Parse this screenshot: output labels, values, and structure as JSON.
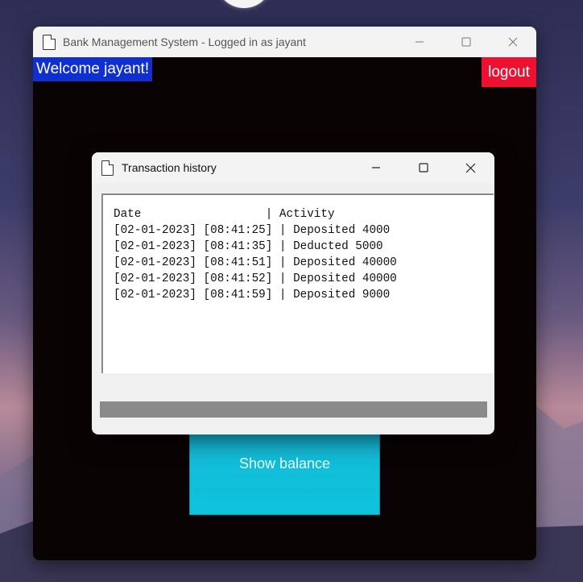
{
  "main_window": {
    "title": "Bank Management System - Logged in as jayant",
    "welcome_text": "Welcome jayant!",
    "logout_label": "logout",
    "show_balance_label": "Show balance"
  },
  "dialog": {
    "title": "Transaction history",
    "header_line": "Date                  | Activity",
    "rows": [
      "[02-01-2023] [08:41:25] | Deposited 4000",
      "[02-01-2023] [08:41:35] | Deducted 5000",
      "[02-01-2023] [08:41:51] | Deposited 40000",
      "[02-01-2023] [08:41:52] | Deposited 40000",
      "[02-01-2023] [08:41:59] | Deposited 9000"
    ]
  },
  "colors": {
    "welcome_bg": "#0f2fd0",
    "logout_bg": "#ee1030",
    "show_balance_bg": "#15b7d5",
    "window_bg": "#0a0304"
  },
  "icons": {
    "window_icon": "document-icon",
    "minimize": "minimize-icon",
    "maximize": "maximize-icon",
    "close": "close-icon"
  }
}
